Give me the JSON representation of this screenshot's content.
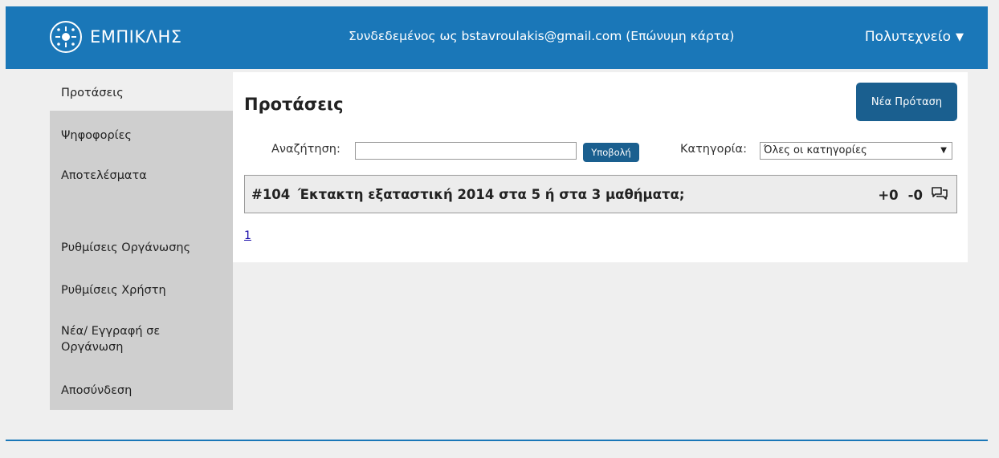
{
  "header": {
    "brand": "ΕΜΠΙΚΛΗΣ",
    "logged_in_text": "Συνδεδεμένος ως bstavroulakis@gmail.com (Επώνυμη κάρτα)",
    "org_menu_label": "Πολυτεχνείο",
    "org_menu_icon": "caret-down-icon",
    "logo_icon": "logo-icon",
    "bg_color": "#1a77b8"
  },
  "sidebar": {
    "items": [
      {
        "label": "Προτάσεις",
        "active": true
      },
      {
        "label": "Ψηφοφορίες"
      },
      {
        "label": "Αποτελέσματα"
      },
      {
        "label": "Ρυθμίσεις Οργάνωσης"
      },
      {
        "label": "Ρυθμίσεις Χρήστη"
      },
      {
        "label": "Νέα/ Εγγραφή σε Οργάνωση"
      },
      {
        "label": "Αποσύνδεση"
      }
    ]
  },
  "main": {
    "title": "Προτάσεις",
    "new_button": "Νέα Πρόταση",
    "search": {
      "label": "Αναζήτηση:",
      "value": "",
      "submit": "Υποβολή"
    },
    "category": {
      "label": "Κατηγορία:",
      "selected": "Όλες οι κατηγορίες"
    },
    "proposals": [
      {
        "id": "#104",
        "title": "Έκτακτη εξαταστική 2014 στα 5 ή στα 3 μαθήματα;",
        "up": "+0",
        "down": "-0",
        "comment_icon": "comments-icon"
      }
    ],
    "pagination": [
      "1"
    ]
  },
  "colors": {
    "accent": "#1a77b8",
    "button": "#1a5f8f",
    "sidebar_bg": "#cfcfcf",
    "page_bg": "#efefef"
  }
}
